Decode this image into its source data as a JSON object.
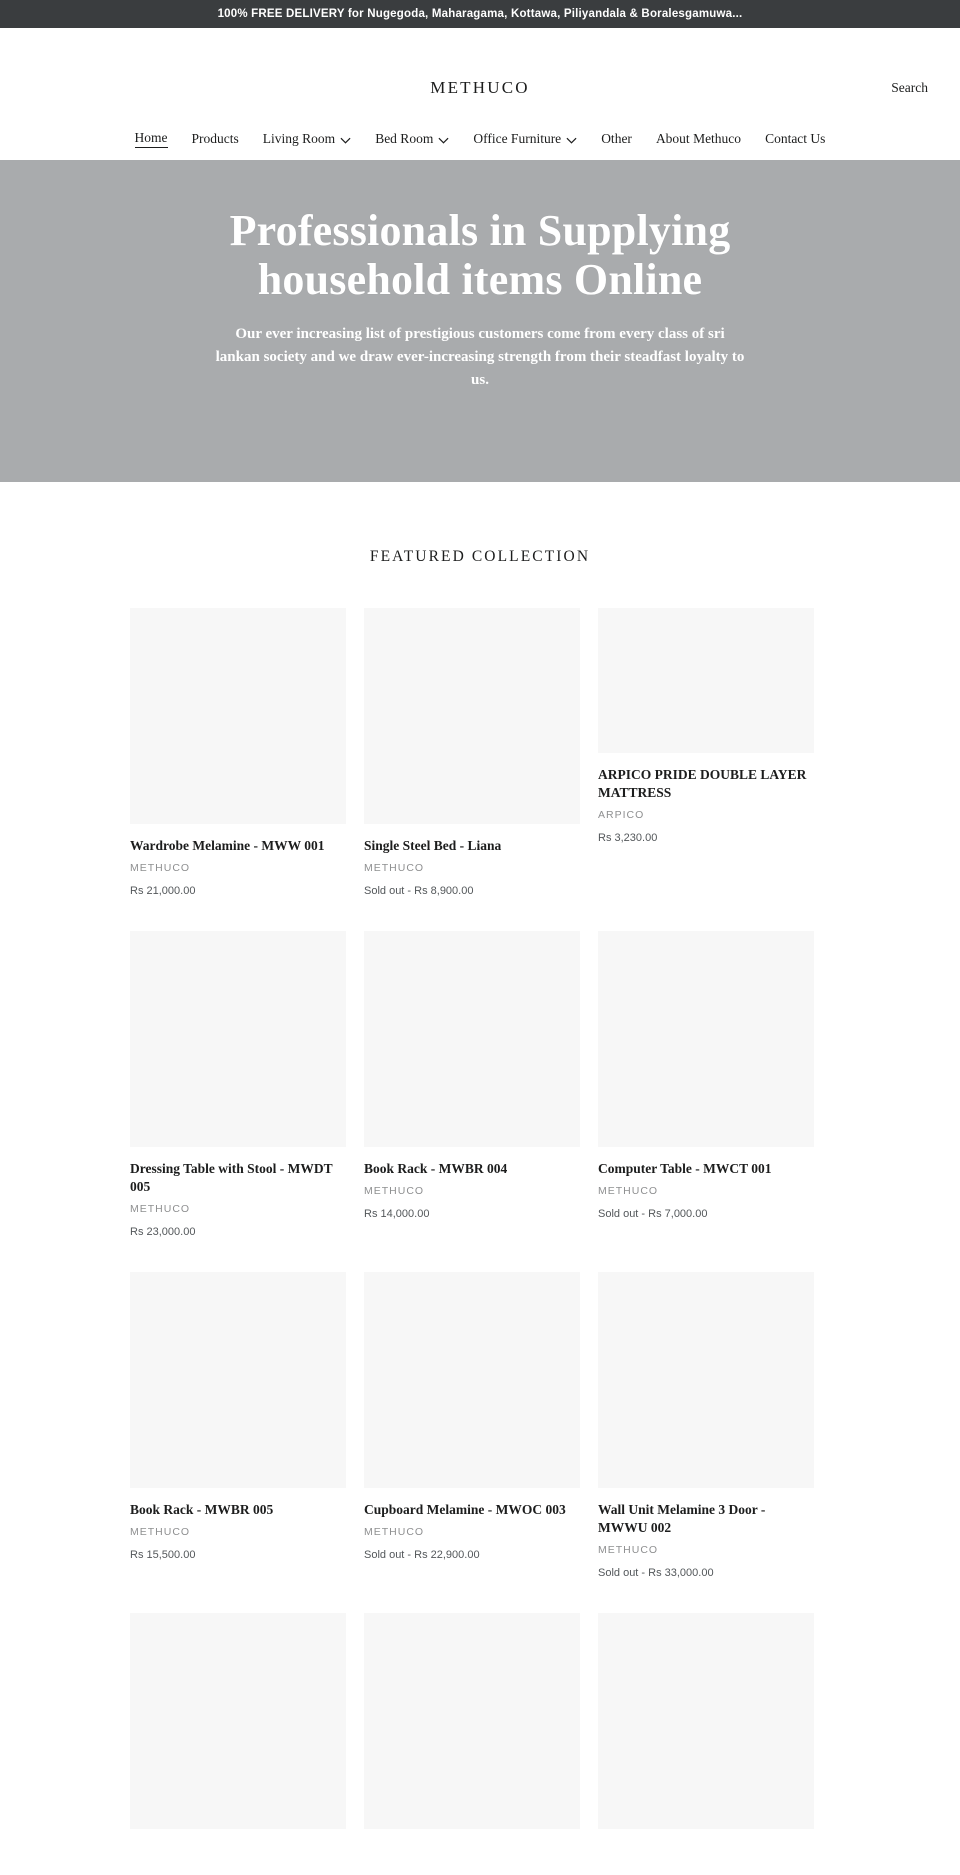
{
  "announcement": {
    "text": "100% FREE DELIVERY for Nugegoda, Maharagama, Kottawa, Piliyandala & Boralesgamuwa..."
  },
  "header": {
    "logo": "METHUCO",
    "search_label": "Search"
  },
  "nav": {
    "items": [
      {
        "label": "Home",
        "has_caret": false,
        "active": true
      },
      {
        "label": "Products",
        "has_caret": false,
        "active": false
      },
      {
        "label": "Living Room",
        "has_caret": true,
        "active": false
      },
      {
        "label": "Bed Room",
        "has_caret": true,
        "active": false
      },
      {
        "label": "Office Furniture",
        "has_caret": true,
        "active": false
      },
      {
        "label": "Other",
        "has_caret": false,
        "active": false
      },
      {
        "label": "About Methuco",
        "has_caret": false,
        "active": false
      },
      {
        "label": "Contact Us",
        "has_caret": false,
        "active": false
      }
    ]
  },
  "hero": {
    "title": "Professionals in Supplying household items Online",
    "subtitle": "Our ever increasing list of prestigious customers come from every class of sri lankan society and we draw ever-increasing strength from their steadfast loyalty to us.",
    "background_color": "#a9abad"
  },
  "featured": {
    "title": "FEATURED COLLECTION",
    "products": [
      {
        "title": "Wardrobe Melamine - MWW 001",
        "vendor": "METHUCO",
        "price": "Rs 21,000.00",
        "media_height": 216,
        "media_top": 0
      },
      {
        "title": "Single Steel Bed - Liana",
        "vendor": "METHUCO",
        "price": "Sold out - Rs 8,900.00",
        "media_height": 216,
        "media_top": 0
      },
      {
        "title": "ARPICO PRIDE DOUBLE LAYER MATTRESS",
        "vendor": "ARPICO",
        "price": "Rs 3,230.00",
        "media_height": 145,
        "media_top": 0
      },
      {
        "title": "Dressing Table with Stool - MWDT 005",
        "vendor": "METHUCO",
        "price": "Rs 23,000.00",
        "media_height": 216,
        "media_top": 0
      },
      {
        "title": "Book Rack - MWBR 004",
        "vendor": "METHUCO",
        "price": "Rs 14,000.00",
        "media_height": 216,
        "media_top": 0
      },
      {
        "title": "Computer Table - MWCT 001",
        "vendor": "METHUCO",
        "price": "Sold out - Rs 7,000.00",
        "media_height": 216,
        "media_top": 0
      },
      {
        "title": "Book Rack - MWBR 005",
        "vendor": "METHUCO",
        "price": "Rs 15,500.00",
        "media_height": 216,
        "media_top": 0
      },
      {
        "title": "Cupboard Melamine - MWOC 003",
        "vendor": "METHUCO",
        "price": "Sold out - Rs 22,900.00",
        "media_height": 216,
        "media_top": 0
      },
      {
        "title": "Wall Unit Melamine 3 Door - MWWU 002",
        "vendor": "METHUCO",
        "price": "Sold out - Rs 33,000.00",
        "media_height": 216,
        "media_top": 0
      },
      {
        "title": "",
        "vendor": "",
        "price": "",
        "media_height": 216,
        "media_top": 0
      },
      {
        "title": "",
        "vendor": "",
        "price": "",
        "media_height": 216,
        "media_top": 0
      },
      {
        "title": "",
        "vendor": "",
        "price": "",
        "media_height": 216,
        "media_top": 0
      }
    ]
  },
  "icons": {
    "caret": "chevron-down-icon"
  },
  "colors": {
    "announcement_bg": "#3a3d3f",
    "hero_bg": "#a9abad",
    "text": "#1c1d1d",
    "muted": "#8e8f90",
    "media_placeholder": "#f7f7f7"
  }
}
